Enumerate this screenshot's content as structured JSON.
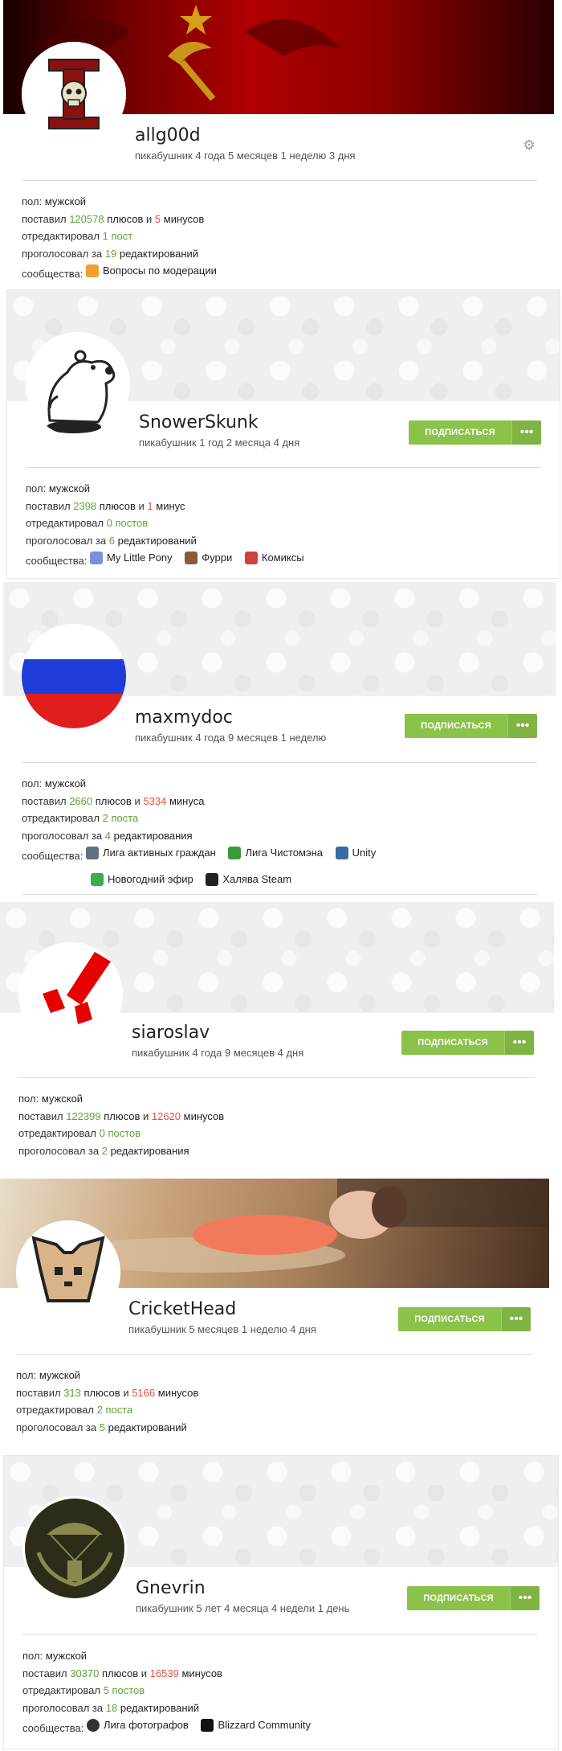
{
  "labels": {
    "sex": "пол:",
    "rated": "поставил",
    "and": "и",
    "edited": "отредактировал",
    "voted": "проголосовал за",
    "communities": "сообщества:",
    "subscribe": "ПОДПИСАТЬСЯ",
    "more": "•••"
  },
  "users": [
    {
      "name": "allg00d",
      "tenure": "пикабушник 4 года 5 месяцев 1 неделю 3 дня",
      "sex": "мужской",
      "pluses": "120578",
      "pluses_word": "плюсов",
      "minuses": "5",
      "minuses_word": "минусов",
      "edited": "1 пост",
      "votes": "19",
      "votes_word": "редактирований",
      "communities": [
        {
          "label": "Вопросы по модерации",
          "icon": "question-icon",
          "color": "#f0a030"
        }
      ]
    },
    {
      "name": "SnowerSkunk",
      "tenure": "пикабушник 1 год 2 месяца 4 дня",
      "sex": "мужской",
      "pluses": "2398",
      "pluses_word": "плюсов",
      "minuses": "1",
      "minuses_word": "минус",
      "edited": "0 постов",
      "votes": "6",
      "votes_word": "редактирований",
      "communities": [
        {
          "label": "My Little Pony",
          "icon": "pony-icon",
          "color": "#7a8fe0"
        },
        {
          "label": "Фурри",
          "icon": "furry-icon",
          "color": "#8a5a3a"
        },
        {
          "label": "Комиксы",
          "icon": "comics-icon",
          "color": "#d04040"
        }
      ]
    },
    {
      "name": "maxmydoc",
      "tenure": "пикабушник 4 года 9 месяцев 1 неделю",
      "sex": "мужской",
      "pluses": "2660",
      "pluses_word": "плюсов",
      "minuses": "5334",
      "minuses_word": "минуса",
      "edited": "2 поста",
      "votes": "4",
      "votes_word": "редактирования",
      "communities": [
        {
          "label": "Лига активных граждан",
          "icon": "citizens-icon",
          "color": "#607080"
        },
        {
          "label": "Лига Чистомэна",
          "icon": "cleanman-icon",
          "color": "#3a9a3a"
        },
        {
          "label": "Unity",
          "icon": "unity-icon",
          "color": "#3a6aa0"
        },
        {
          "label": "Новогодний эфир",
          "icon": "newyear-icon",
          "color": "#38b048"
        },
        {
          "label": "Халява Steam",
          "icon": "steam-icon",
          "color": "#222222"
        }
      ]
    },
    {
      "name": "siaroslav",
      "tenure": "пикабушник 4 года 9 месяцев 4 дня",
      "sex": "мужской",
      "pluses": "122399",
      "pluses_word": "плюсов",
      "minuses": "12620",
      "minuses_word": "минусов",
      "edited": "0 постов",
      "votes": "2",
      "votes_word": "редактирования",
      "communities": []
    },
    {
      "name": "CricketHead",
      "tenure": "пикабушник 5 месяцев 1 неделю 4 дня",
      "sex": "мужской",
      "pluses": "313",
      "pluses_word": "плюсов",
      "minuses": "5166",
      "minuses_word": "минусов",
      "edited": "2 поста",
      "votes": "5",
      "votes_word": "редактирований",
      "communities": []
    },
    {
      "name": "Gnevrin",
      "tenure": "пикабушник 5 лет 4 месяца 4 недели 1 день",
      "sex": "мужской",
      "pluses": "30370",
      "pluses_word": "плюсов",
      "minuses": "16539",
      "minuses_word": "минусов",
      "edited": "5 постов",
      "votes": "18",
      "votes_word": "редактирований",
      "communities": [
        {
          "label": "Лига фотографов",
          "icon": "camera-icon",
          "color": "#333333"
        },
        {
          "label": "Blizzard Community",
          "icon": "blizzard-icon",
          "color": "#111111"
        }
      ]
    }
  ],
  "colors": {
    "accent": "#8bc34a",
    "plus": "#5aa63a",
    "minus": "#e4503b"
  }
}
